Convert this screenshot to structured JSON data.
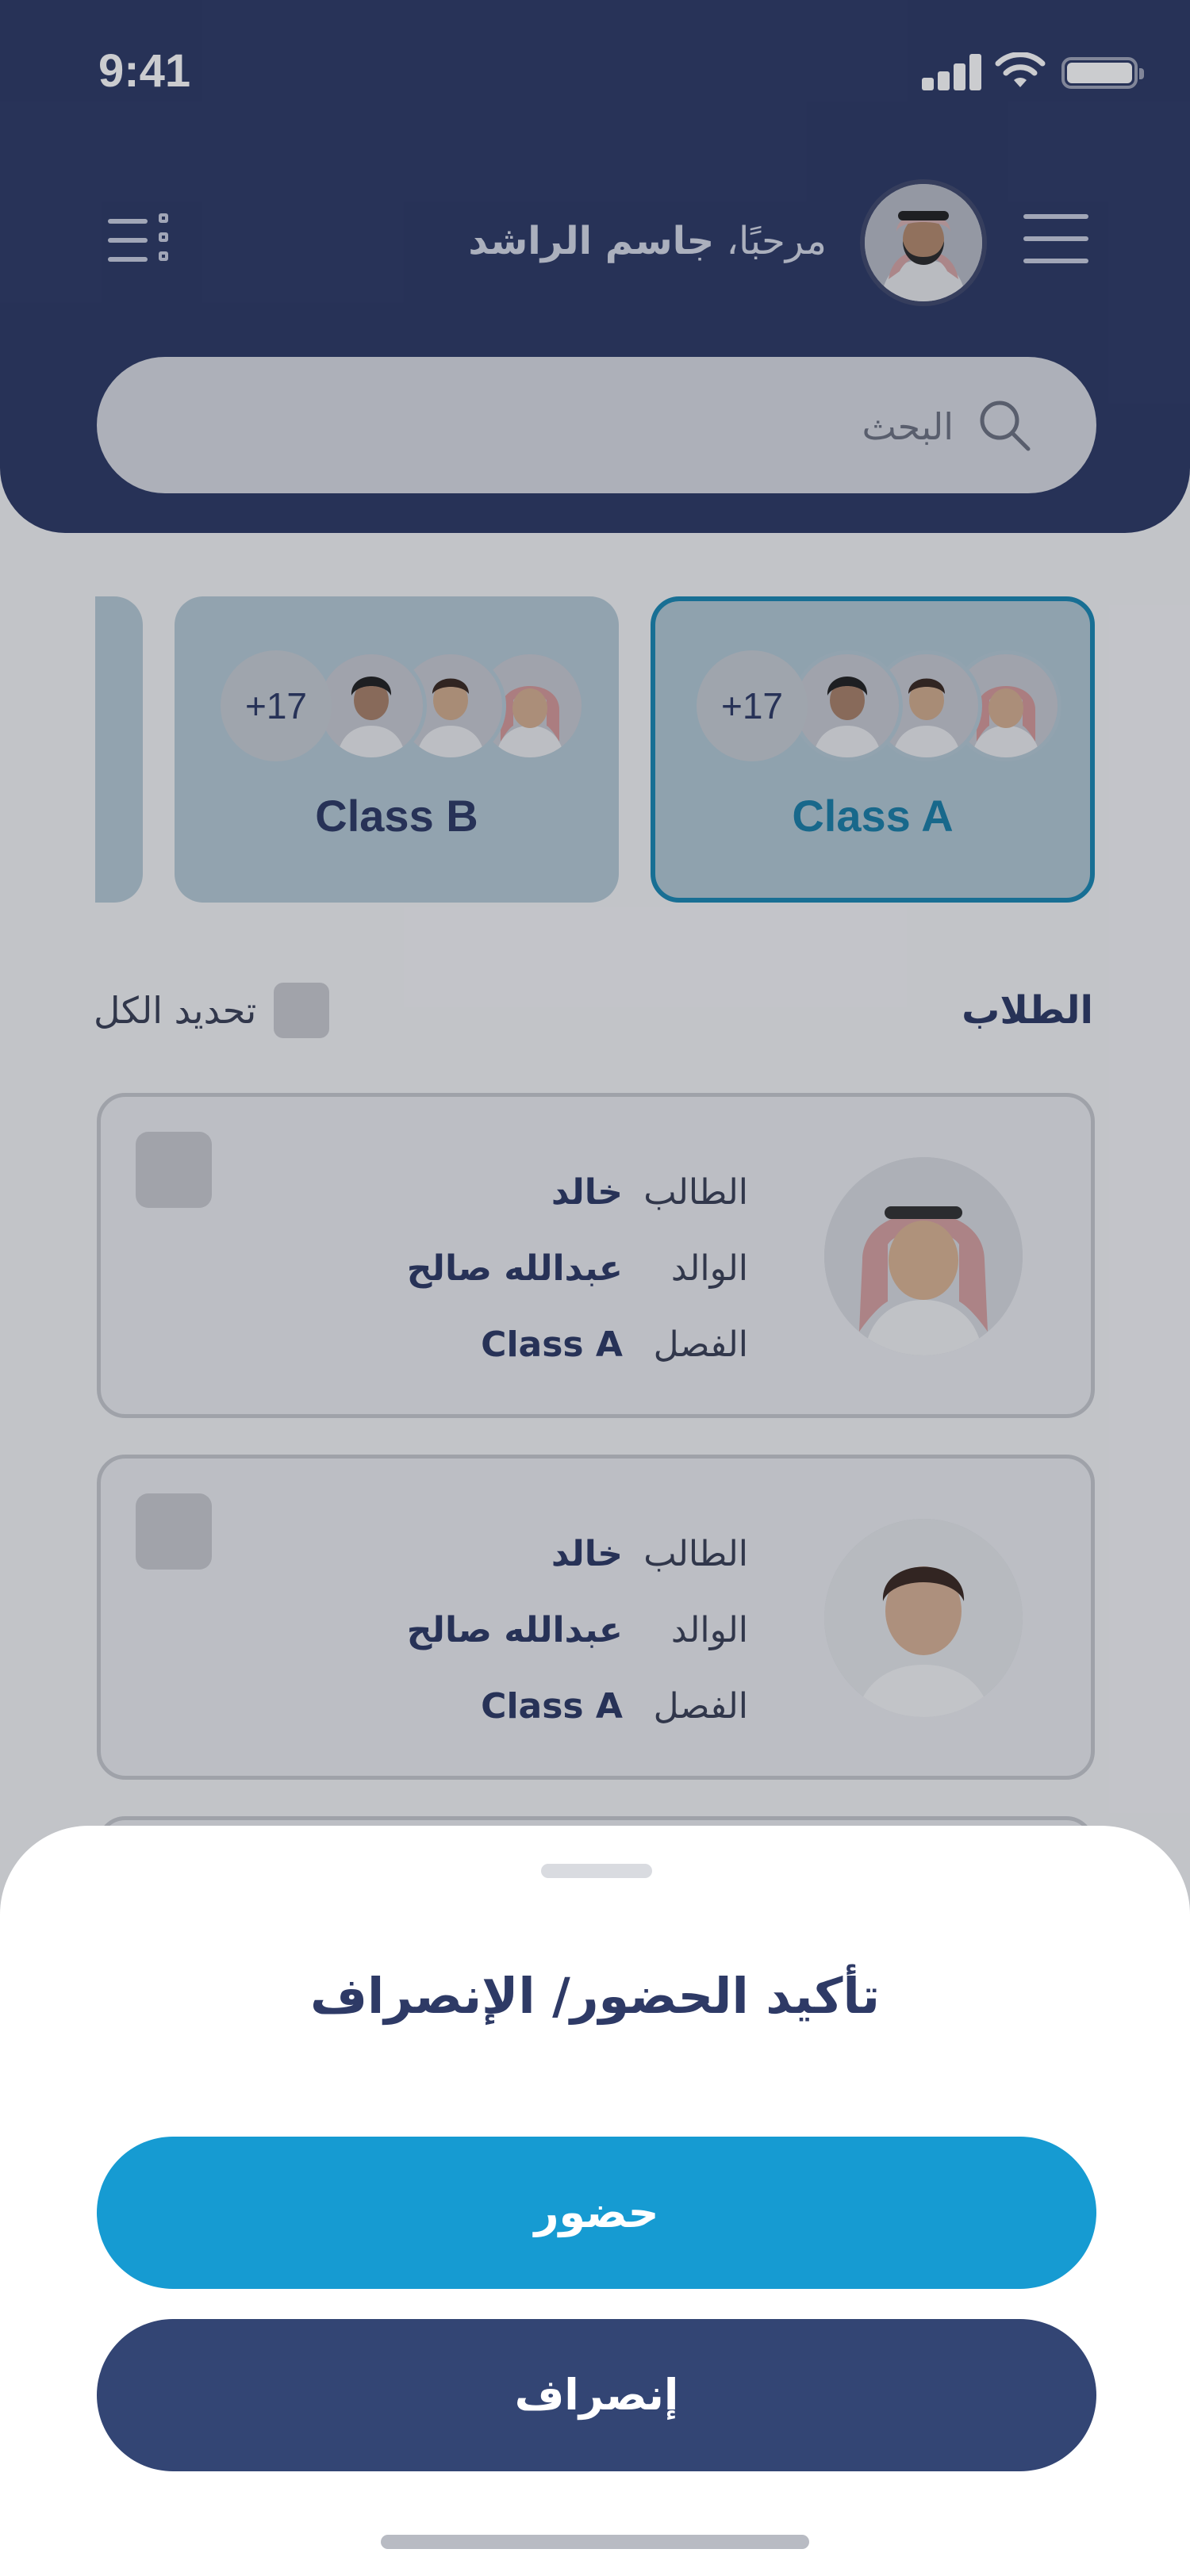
{
  "status_bar": {
    "time": "9:41"
  },
  "header": {
    "greeting_prefix": "مرحبًا، ",
    "user_name": "جاسم الراشد",
    "search_placeholder": "البحث"
  },
  "classes": [
    {
      "label": "Class A",
      "extra_count": "+17",
      "selected": true
    },
    {
      "label": "Class B",
      "extra_count": "+17",
      "selected": false
    }
  ],
  "students_section": {
    "title": "الطلاب",
    "select_all_label": "تحديد الكل"
  },
  "field_labels": {
    "student": "الطالب",
    "parent": "الوالد",
    "class": "الفصل"
  },
  "students": [
    {
      "student": "خالد",
      "parent": "عبدالله صالح",
      "class": "Class A"
    },
    {
      "student": "خالد",
      "parent": "عبدالله صالح",
      "class": "Class A"
    }
  ],
  "sheet": {
    "title": "تأكيد الحضور/ الإنصراف",
    "present_label": "حضور",
    "leave_label": "إنصراف"
  },
  "colors": {
    "primary_dark": "#2e3a66",
    "accent_blue": "#169bd2",
    "leave_button": "#334574"
  },
  "icons": [
    "menu-icon",
    "filter-list-icon",
    "search-icon",
    "signal-icon",
    "wifi-icon",
    "battery-icon"
  ]
}
